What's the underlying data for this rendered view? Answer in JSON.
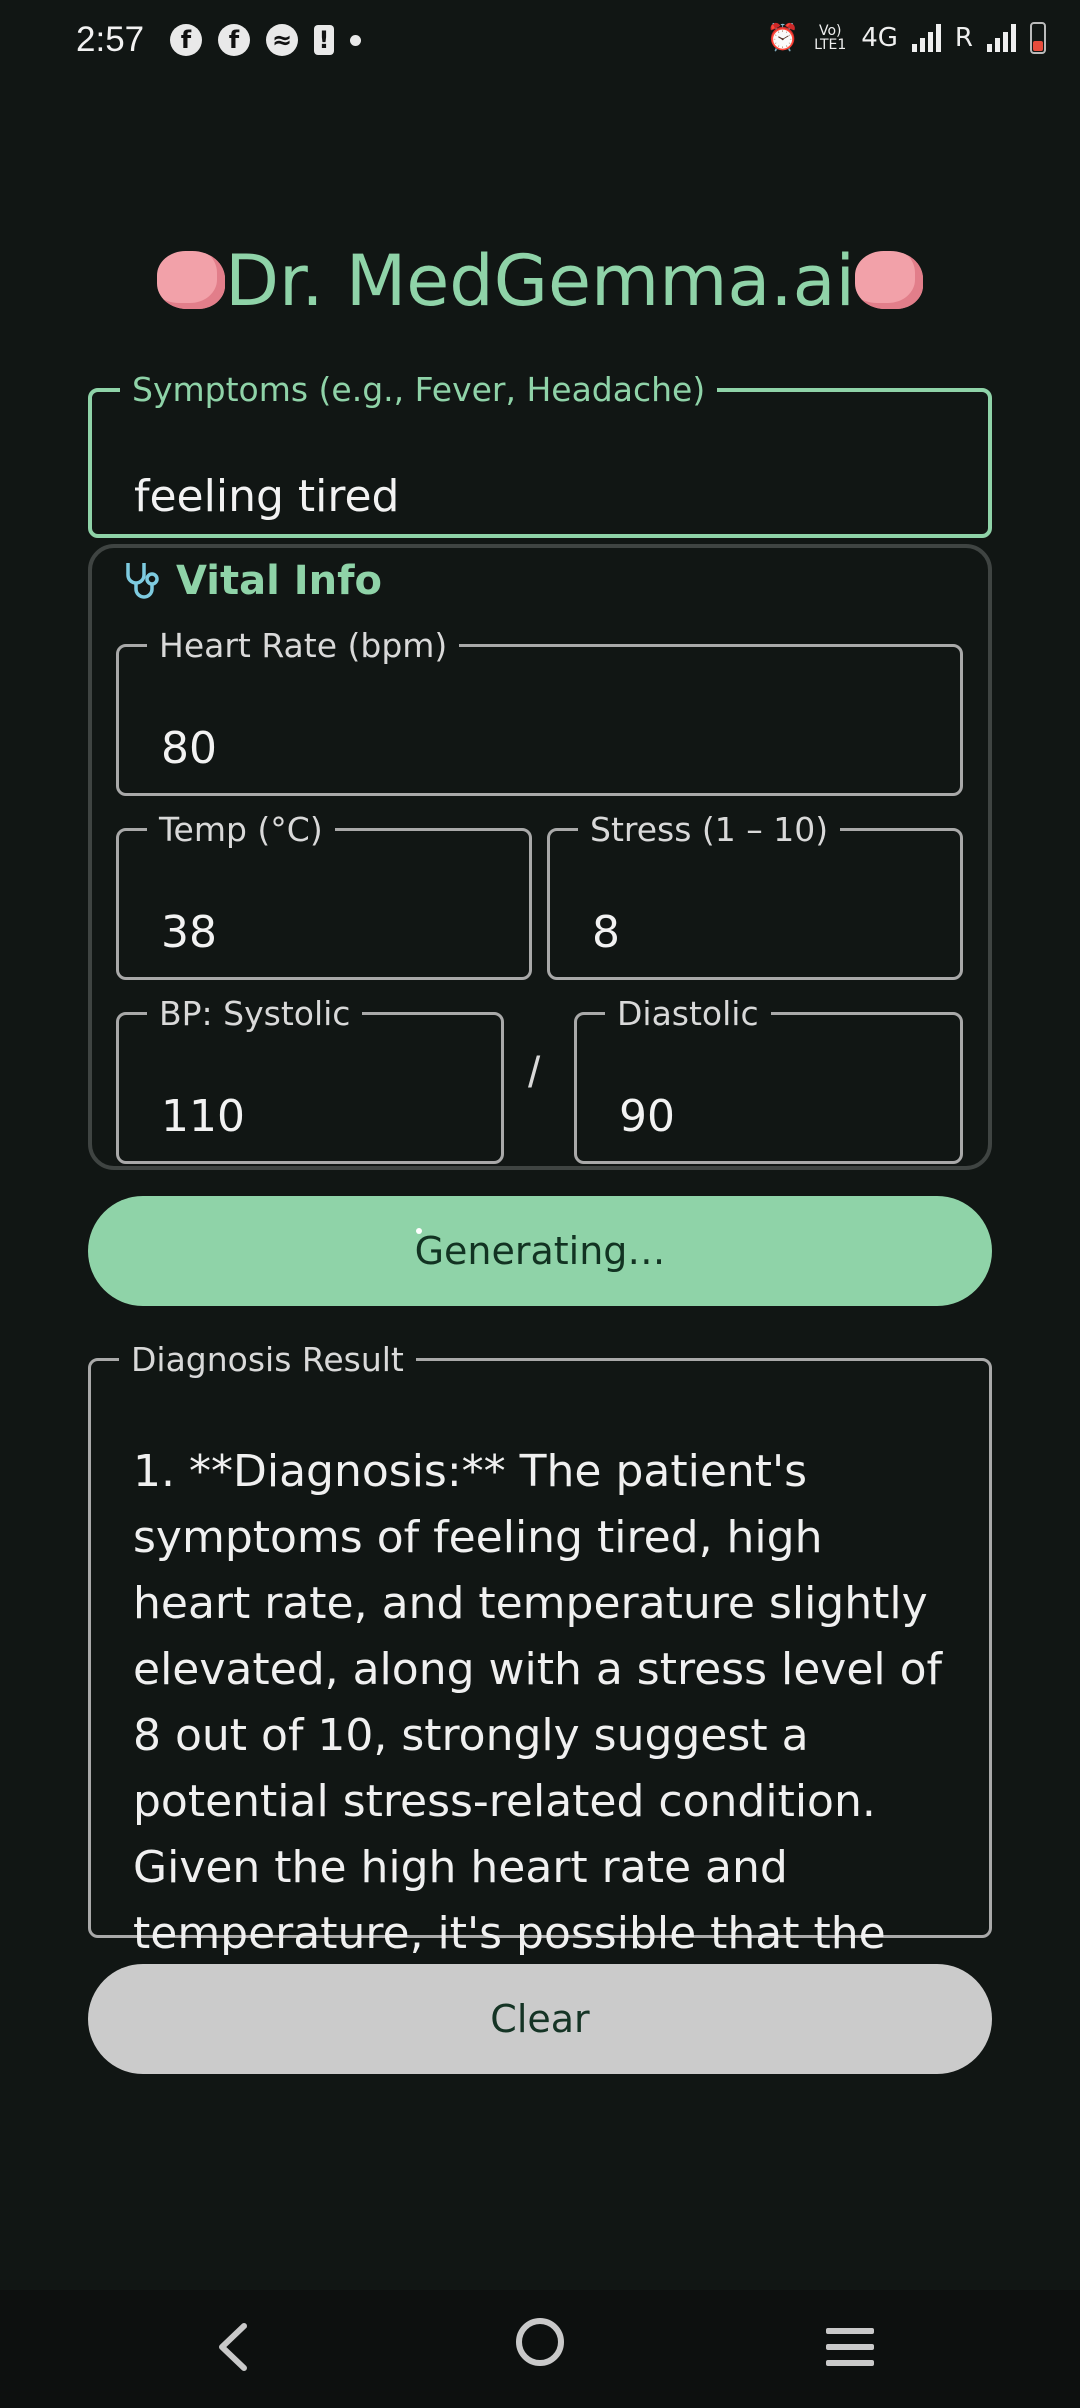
{
  "status_bar": {
    "time": "2:57",
    "lte_label": "Vo) LTE1",
    "network": "4G",
    "roaming": "R"
  },
  "app": {
    "title": "Dr. MedGemma.ai",
    "accent_color": "#8fd3a8"
  },
  "symptoms": {
    "label": "Symptoms (e.g., Fever, Headache)",
    "value": "feeling tired"
  },
  "vital_info": {
    "heading": "Vital Info",
    "heart_rate": {
      "label": "Heart Rate (bpm)",
      "value": "80"
    },
    "temp": {
      "label": "Temp (°C)",
      "value": "38"
    },
    "stress": {
      "label": "Stress (1 – 10)",
      "value": "8"
    },
    "bp_systolic": {
      "label": "BP: Systolic",
      "value": "110"
    },
    "separator": "/",
    "bp_diastolic": {
      "label": "Diastolic",
      "value": "90"
    }
  },
  "generate_button": {
    "label": "Generating…"
  },
  "diagnosis": {
    "label": "Diagnosis Result",
    "text": "1. **Diagnosis:** The patient's symptoms of feeling tired, high heart rate, and temperature slightly elevated, along with a stress level of 8 out of 10, strongly suggest a potential stress-related condition. Given the high heart rate and temperature, it's possible that the"
  },
  "clear_button": {
    "label": "Clear"
  },
  "nav": {
    "back_icon": "chevron-left",
    "home_icon": "circle",
    "recent_icon": "three-lines"
  }
}
